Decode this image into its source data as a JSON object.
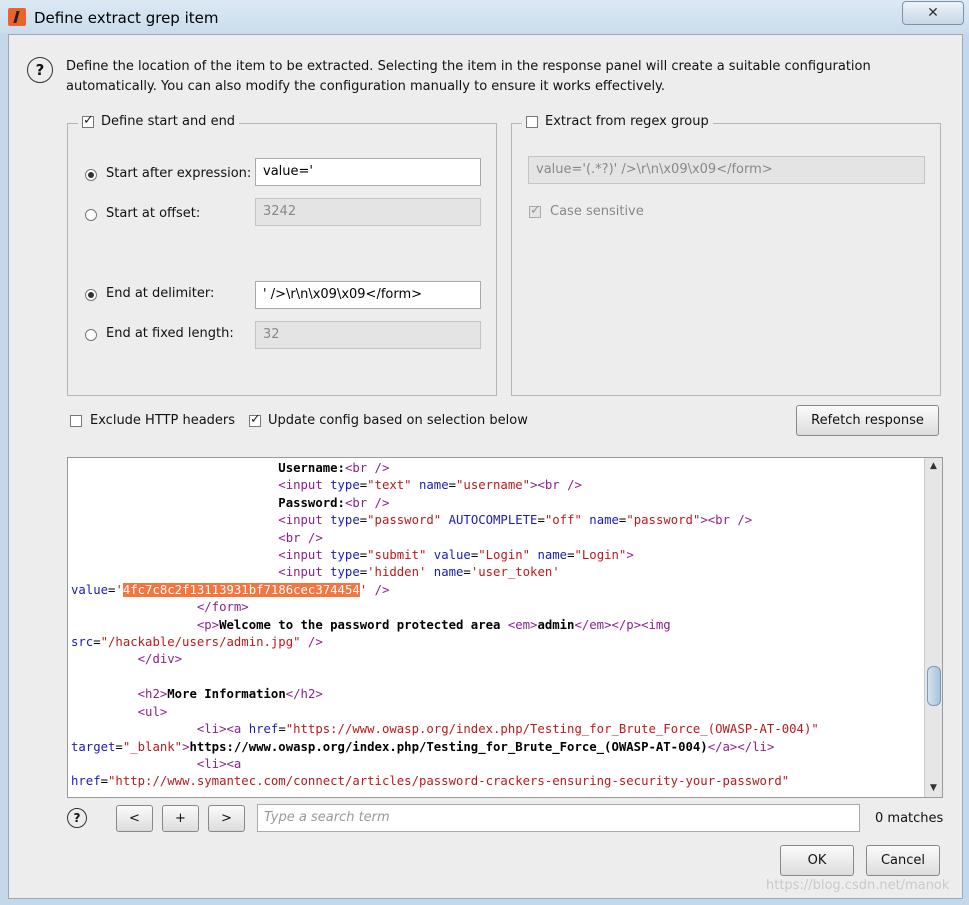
{
  "window": {
    "title": "Define extract grep item",
    "close_glyph": "✕"
  },
  "description": "Define the location of the item to be extracted. Selecting the item in the response panel will create a suitable configuration automatically. You can also modify the configuration manually to ensure it works effectively.",
  "start_end_group": {
    "label": "Define start and end",
    "checked": true,
    "start_after_label": "Start after expression:",
    "start_after_value": "value='",
    "start_offset_label": "Start at offset:",
    "start_offset_value": "3242",
    "end_delim_label": "End at delimiter:",
    "end_delim_value": "' />\\r\\n\\x09\\x09</form>",
    "end_fixed_label": "End at fixed length:",
    "end_fixed_value": "32"
  },
  "regex_group": {
    "label": "Extract from regex group",
    "checked": false,
    "regex_value": "value='(.*?)' />\\r\\n\\x09\\x09</form>",
    "case_label": "Case sensitive",
    "case_checked": true
  },
  "options": {
    "exclude_headers_label": "Exclude HTTP headers",
    "exclude_headers_checked": false,
    "update_config_label": "Update config based on selection below",
    "update_config_checked": true,
    "refetch_label": "Refetch response"
  },
  "response_panel": {
    "selected_token": "4fc7c8c2f13113931bf7186cec374454"
  },
  "search": {
    "placeholder": "Type a search term",
    "prev_label": "<",
    "add_label": "+",
    "next_label": ">",
    "matches_text": "0 matches"
  },
  "footer": {
    "ok_label": "OK",
    "cancel_label": "Cancel",
    "watermark": "https://blog.csdn.net/manok"
  },
  "icons": {
    "help": "help-circle-icon",
    "app": "burp-app-icon"
  }
}
